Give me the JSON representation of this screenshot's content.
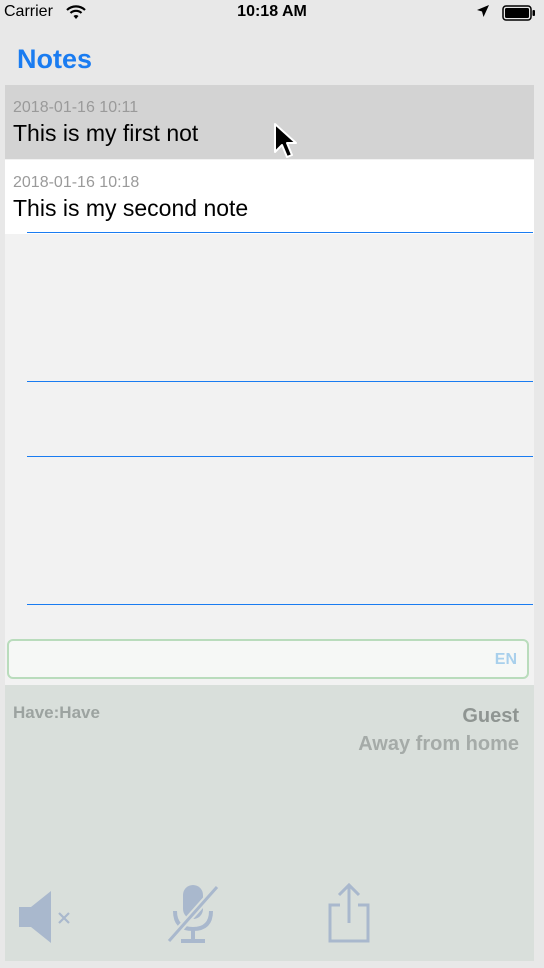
{
  "status_bar": {
    "carrier": "Carrier",
    "time": "10:18 AM",
    "icons": [
      "wifi-icon",
      "location-arrow-icon",
      "battery-icon"
    ]
  },
  "nav": {
    "title": "Notes"
  },
  "notes": [
    {
      "date": "2018-01-16 10:11",
      "title": "This is my first not"
    },
    {
      "date": "2018-01-16 10:18",
      "title": "This is my second note"
    }
  ],
  "input": {
    "language": "EN"
  },
  "info": {
    "have": "Have:Have",
    "user": "Guest",
    "status": "Away from home"
  },
  "toolbar": {
    "icons": [
      "speaker-muted-icon",
      "microphone-off-icon",
      "share-icon"
    ]
  },
  "colors": {
    "accent": "#1a7cf1",
    "selected_row": "#d3d3d3",
    "panel": "#d9dfdb",
    "toolbar_icon": "#a9b8cd"
  }
}
